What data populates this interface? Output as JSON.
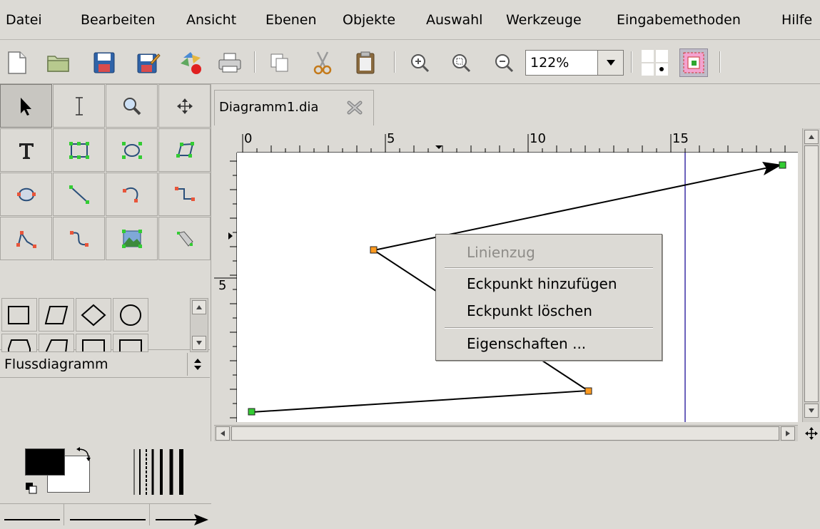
{
  "menubar": {
    "items": [
      {
        "label": "Datei"
      },
      {
        "label": "Bearbeiten"
      },
      {
        "label": "Ansicht"
      },
      {
        "label": "Ebenen"
      },
      {
        "label": "Objekte"
      },
      {
        "label": "Auswahl"
      },
      {
        "label": "Werkzeuge"
      },
      {
        "label": "Eingabemethoden"
      },
      {
        "label": "Hilfe"
      }
    ]
  },
  "toolbar": {
    "zoom_value": "122%",
    "icons": [
      "new-file-icon",
      "open-folder-icon",
      "save-icon",
      "save-as-icon",
      "export-icon",
      "print-icon",
      "copy-icon",
      "cut-icon",
      "paste-icon",
      "zoom-in-icon",
      "zoom-fit-icon",
      "zoom-out-icon",
      "grid-toggle-icon",
      "snap-to-grid-icon"
    ]
  },
  "toolbox": {
    "sheet_name": "Flussdiagramm"
  },
  "document": {
    "tab_title": "Diagramm1.dia"
  },
  "ruler": {
    "h_labels": [
      "0",
      "5",
      "10",
      "15"
    ],
    "v_labels": [
      "5"
    ]
  },
  "context_menu": {
    "header": "Linienzug",
    "items": [
      "Eckpunkt hinzufügen",
      "Eckpunkt löschen"
    ],
    "properties": "Eigenschaften ..."
  },
  "colors": {
    "guide_line": "#3b2ea6",
    "handle_fill": "#ff9a1f",
    "handle_end": "#33cc33"
  }
}
